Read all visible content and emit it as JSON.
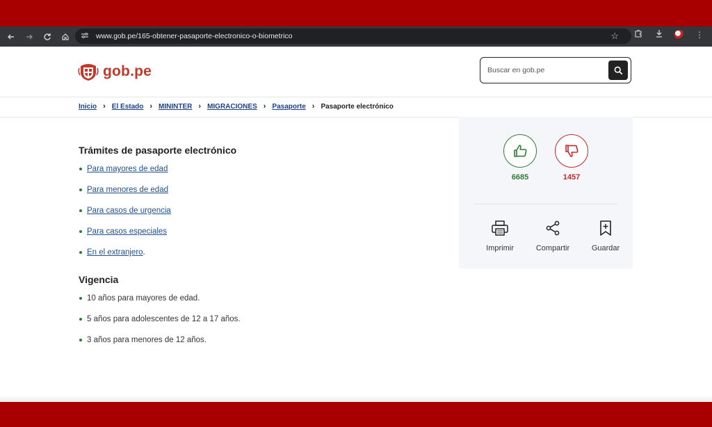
{
  "browser": {
    "url": "www.gob.pe/165-obtener-pasaporte-electronico-o-biometrico"
  },
  "header": {
    "logo_text": "gob.pe",
    "search_placeholder": "Buscar en gob.pe"
  },
  "breadcrumb": {
    "items": [
      "Inicio",
      "El Estado",
      "MININTER",
      "MIGRACIONES",
      "Pasaporte"
    ],
    "current": "Pasaporte electrónico"
  },
  "tramites": {
    "title": "Trámites de pasaporte electrónico",
    "items": [
      "Para mayores de edad",
      "Para menores de edad",
      "Para casos de urgencia",
      "Para casos especiales",
      "En el extranjero"
    ],
    "last_suffix": "."
  },
  "vigencia": {
    "title": "Vigencia",
    "items": [
      "10 años para mayores de edad.",
      "5 años para adolescentes de 12 a 17 años.",
      "3 años para menores de 12 años."
    ]
  },
  "feedback": {
    "likes": "6685",
    "dislikes": "1457",
    "like_color": "#2e7d32",
    "dislike_color": "#c62828"
  },
  "actions": {
    "print": "Imprimir",
    "share": "Compartir",
    "save": "Guardar"
  },
  "icons": {
    "back": "arrow-left-icon",
    "forward": "arrow-right-icon",
    "reload": "reload-icon",
    "home": "home-icon",
    "search": "search-icon"
  },
  "colors": {
    "brand_red": "#c0392b",
    "link_blue": "#1f4f96",
    "outer_frame": "#a80000"
  }
}
